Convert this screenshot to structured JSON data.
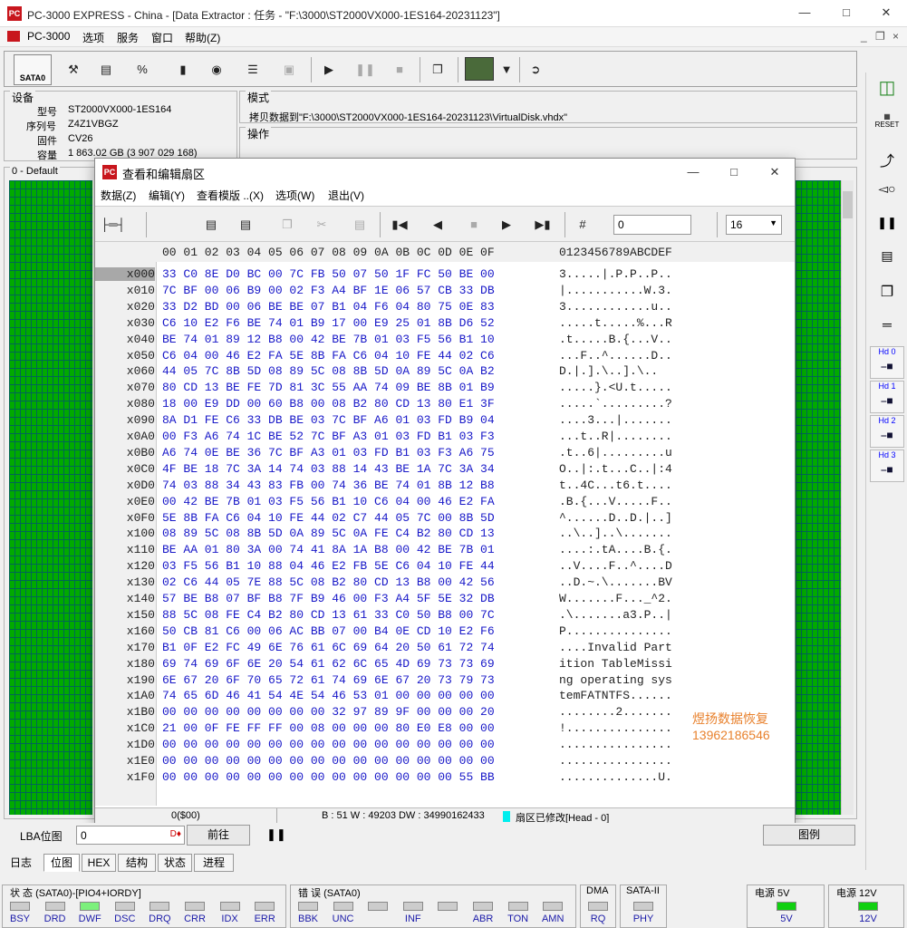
{
  "window": {
    "title": "PC-3000 EXPRESS - China - [Data Extractor : 任务 - \"F:\\3000\\ST2000VX000-1ES164-20231123\"]"
  },
  "menu": [
    "PC-3000",
    "选项",
    "服务",
    "窗口",
    "帮助(Z)"
  ],
  "toolbar": {
    "sata_label": "SATA0"
  },
  "device": {
    "caption": "设备",
    "model_label": "型号",
    "model": "ST2000VX000-1ES164",
    "serial_label": "序列号",
    "serial": "Z4Z1VBGZ",
    "fw_label": "固件",
    "fw": "CV26",
    "cap_label": "容量",
    "capacity": "1 863.02 GB (3 907 029 168)"
  },
  "mode": {
    "caption": "模式",
    "text": "拷贝数据到\"F:\\3000\\ST2000VX000-1ES164-20231123\\VirtualDisk.vhdx\""
  },
  "ops": {
    "caption": "操作"
  },
  "map": {
    "caption": "0 - Default"
  },
  "dialog": {
    "title": "查看和编辑扇区",
    "menu": [
      "数据(Z)",
      "编辑(Y)",
      "查看模版 ..(X)",
      "选项(W)",
      "退出(V)"
    ],
    "offset_value": "0",
    "cols_value": "16",
    "header_hex": "00 01 02 03 04 05 06 07 08 09 0A 0B 0C 0D 0E 0F",
    "header_ascii": "0123456789ABCDEF",
    "status_left": "0($00)",
    "status_mid": "B : 51 W : 49203 DW : 34990162433",
    "status_right": "扇区已修改[Head - 0]"
  },
  "rows": [
    {
      "a": "x000",
      "h": "33 C0 8E D0 BC 00 7C FB 50 07 50 1F FC 50 BE 00",
      "t": "3.....|.P.P..P.."
    },
    {
      "a": "x010",
      "h": "7C BF 00 06 B9 00 02 F3 A4 BF 1E 06 57 CB 33 DB",
      "t": "|...........W.3."
    },
    {
      "a": "x020",
      "h": "33 D2 BD 00 06 BE BE 07 B1 04 F6 04 80 75 0E 83",
      "t": "3............u.."
    },
    {
      "a": "x030",
      "h": "C6 10 E2 F6 BE 74 01 B9 17 00 E9 25 01 8B D6 52",
      "t": ".....t.....%...R"
    },
    {
      "a": "x040",
      "h": "BE 74 01 89 12 B8 00 42 BE 7B 01 03 F5 56 B1 10",
      "t": ".t.....B.{...V.."
    },
    {
      "a": "x050",
      "h": "C6 04 00 46 E2 FA 5E 8B FA C6 04 10 FE 44 02 C6",
      "t": "...F..^......D.."
    },
    {
      "a": "x060",
      "h": "44 05 7C 8B 5D 08 89 5C 08 8B 5D 0A 89 5C 0A B2",
      "t": "D.|.].\\..].\\.."
    },
    {
      "a": "x070",
      "h": "80 CD 13 BE FE 7D 81 3C 55 AA 74 09 BE 8B 01 B9",
      "t": ".....}.<U.t....."
    },
    {
      "a": "x080",
      "h": "18 00 E9 DD 00 60 B8 00 08 B2 80 CD 13 80 E1 3F",
      "t": ".....`.........?"
    },
    {
      "a": "x090",
      "h": "8A D1 FE C6 33 DB BE 03 7C BF A6 01 03 FD B9 04",
      "t": "....3...|......."
    },
    {
      "a": "x0A0",
      "h": "00 F3 A6 74 1C BE 52 7C BF A3 01 03 FD B1 03 F3",
      "t": "...t..R|........"
    },
    {
      "a": "x0B0",
      "h": "A6 74 0E BE 36 7C BF A3 01 03 FD B1 03 F3 A6 75",
      "t": ".t..6|.........u"
    },
    {
      "a": "x0C0",
      "h": "4F BE 18 7C 3A 14 74 03 88 14 43 BE 1A 7C 3A 34",
      "t": "O..|:.t...C..|:4"
    },
    {
      "a": "x0D0",
      "h": "74 03 88 34 43 83 FB 00 74 36 BE 74 01 8B 12 B8",
      "t": "t..4C...t6.t...."
    },
    {
      "a": "x0E0",
      "h": "00 42 BE 7B 01 03 F5 56 B1 10 C6 04 00 46 E2 FA",
      "t": ".B.{...V.....F.."
    },
    {
      "a": "x0F0",
      "h": "5E 8B FA C6 04 10 FE 44 02 C7 44 05 7C 00 8B 5D",
      "t": "^......D..D.|..]"
    },
    {
      "a": "x100",
      "h": "08 89 5C 08 8B 5D 0A 89 5C 0A FE C4 B2 80 CD 13",
      "t": "..\\..]..\\......."
    },
    {
      "a": "x110",
      "h": "BE AA 01 80 3A 00 74 41 8A 1A B8 00 42 BE 7B 01",
      "t": "....:.tA....B.{."
    },
    {
      "a": "x120",
      "h": "03 F5 56 B1 10 88 04 46 E2 FB 5E C6 04 10 FE 44",
      "t": "..V....F..^....D"
    },
    {
      "a": "x130",
      "h": "02 C6 44 05 7E 88 5C 08 B2 80 CD 13 B8 00 42 56",
      "t": "..D.~.\\.......BV"
    },
    {
      "a": "x140",
      "h": "57 BE B8 07 BF B8 7F B9 46 00 F3 A4 5F 5E 32 DB",
      "t": "W.......F..._^2."
    },
    {
      "a": "x150",
      "h": "88 5C 08 FE C4 B2 80 CD 13 61 33 C0 50 B8 00 7C",
      "t": ".\\.......a3.P..|"
    },
    {
      "a": "x160",
      "h": "50 CB 81 C6 00 06 AC BB 07 00 B4 0E CD 10 E2 F6",
      "t": "P..............."
    },
    {
      "a": "x170",
      "h": "B1 0F E2 FC 49 6E 76 61 6C 69 64 20 50 61 72 74",
      "t": "....Invalid Part"
    },
    {
      "a": "x180",
      "h": "69 74 69 6F 6E 20 54 61 62 6C 65 4D 69 73 73 69",
      "t": "ition TableMissi"
    },
    {
      "a": "x190",
      "h": "6E 67 20 6F 70 65 72 61 74 69 6E 67 20 73 79 73",
      "t": "ng operating sys"
    },
    {
      "a": "x1A0",
      "h": "74 65 6D 46 41 54 4E 54 46 53 01 00 00 00 00 00",
      "t": "temFATNTFS......"
    },
    {
      "a": "x1B0",
      "h": "00 00 00 00 00 00 00 00 32 97 89 9F 00 00 00 20",
      "t": "........2......."
    },
    {
      "a": "x1C0",
      "h": "21 00 0F FE FF FF 00 08 00 00 00 80 E0 E8 00 00",
      "t": "!..............."
    },
    {
      "a": "x1D0",
      "h": "00 00 00 00 00 00 00 00 00 00 00 00 00 00 00 00",
      "t": "................"
    },
    {
      "a": "x1E0",
      "h": "00 00 00 00 00 00 00 00 00 00 00 00 00 00 00 00",
      "t": "................"
    },
    {
      "a": "x1F0",
      "h": "00 00 00 00 00 00 00 00 00 00 00 00 00 00 55 BB",
      "t": "..............U."
    }
  ],
  "watermark": {
    "line1": "煜扬数据恢复",
    "line2": "13962186546"
  },
  "lba": {
    "label": "LBA位图",
    "value": "0",
    "go": "前往",
    "legend": "图例"
  },
  "tabs": [
    "日志",
    "位图",
    "HEX",
    "结构",
    "状态",
    "进程"
  ],
  "right_hd": [
    "Hd 0",
    "Hd 1",
    "Hd 2",
    "Hd 3"
  ],
  "status": {
    "group1": "状 态 (SATA0)-[PIO4+IORDY]",
    "leds1": [
      "BSY",
      "DRD",
      "DWF",
      "DSC",
      "DRQ",
      "CRR",
      "IDX",
      "ERR"
    ],
    "group2": "错 误 (SATA0)",
    "leds2": [
      "BBK",
      "UNC",
      "",
      "INF",
      "",
      "ABR",
      "TON",
      "AMN"
    ],
    "dma": "DMA",
    "dma_led": "RQ",
    "sata": "SATA-II",
    "sata_led": "PHY",
    "p5": "电源 5V",
    "p5v": "5V",
    "p12": "电源 12V",
    "p12v": "12V"
  },
  "colors": {
    "map_green": "#00aa00",
    "hex_blue": "#1818c8",
    "watermark": "#e8812d"
  }
}
